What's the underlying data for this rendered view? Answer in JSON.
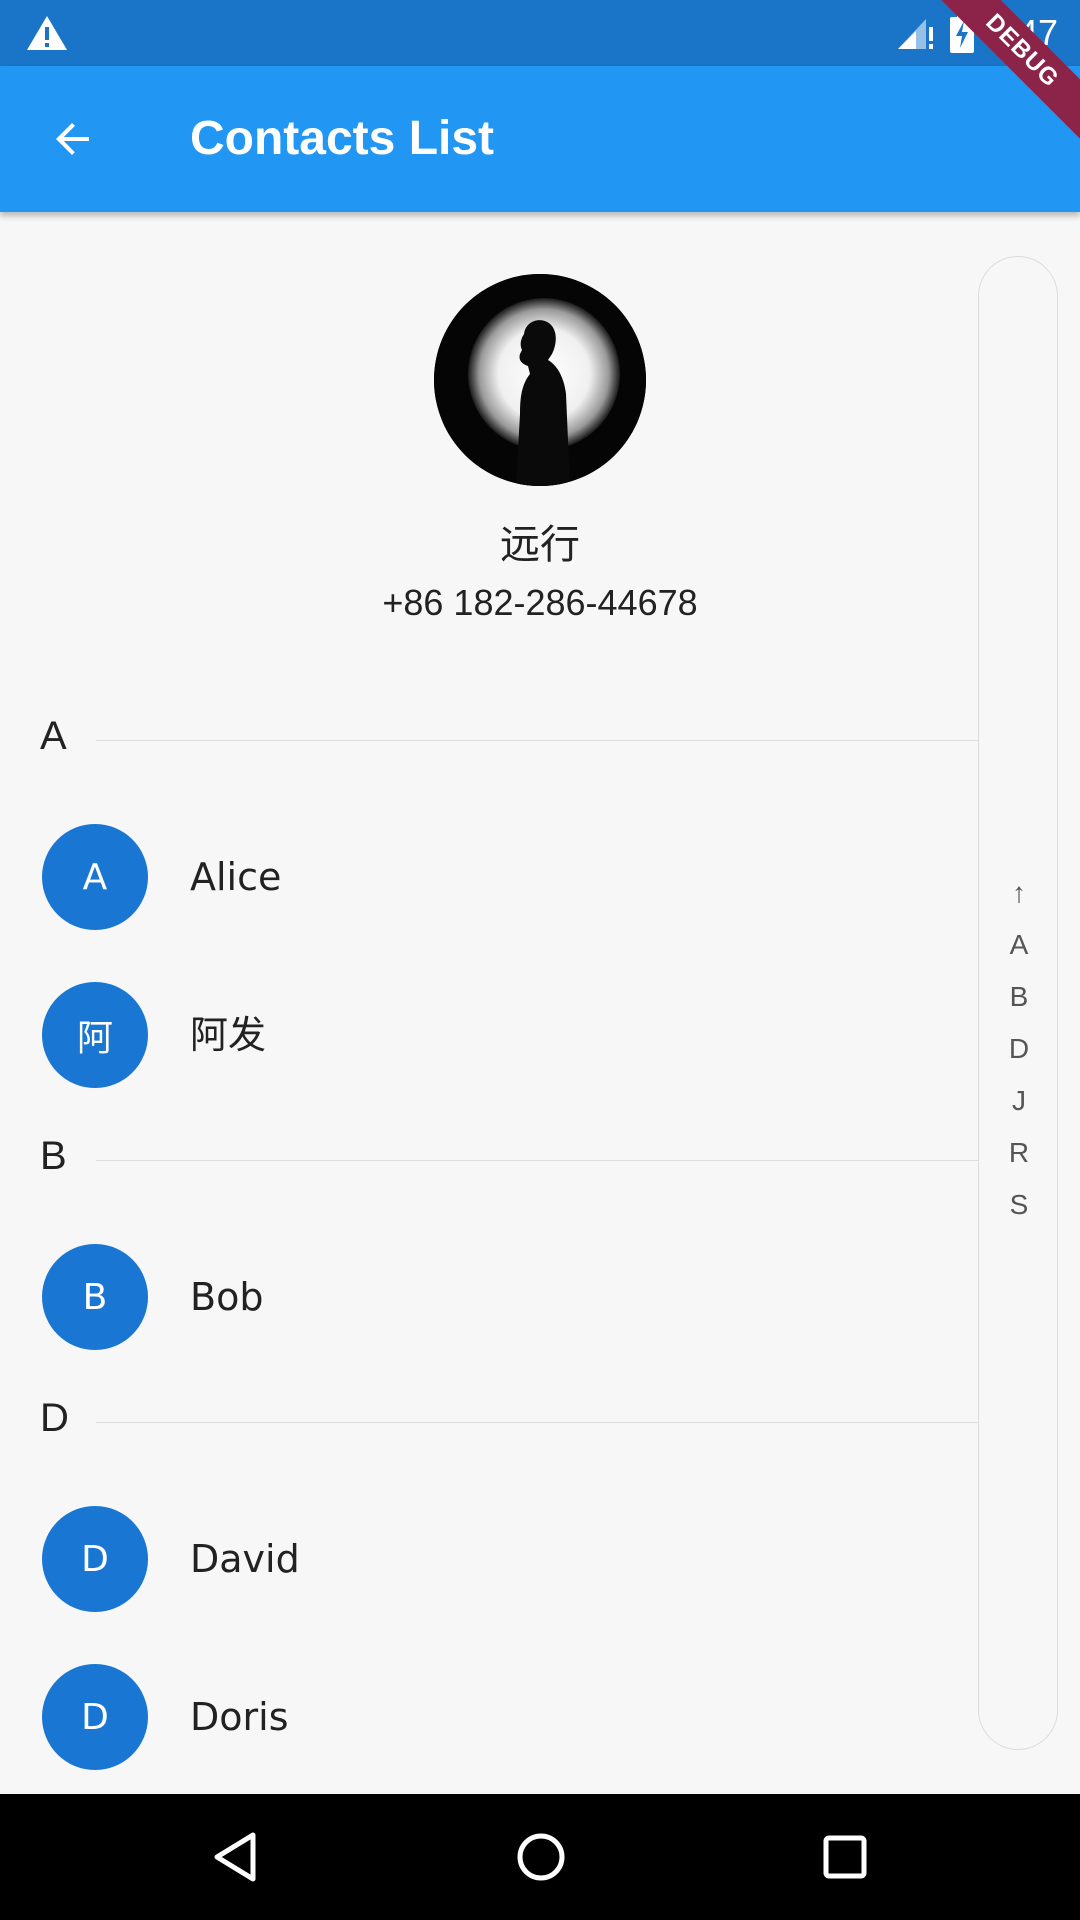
{
  "status_bar": {
    "time": "8:47",
    "debug_label": "DEBUG"
  },
  "app_bar": {
    "title": "Contacts List"
  },
  "profile": {
    "name": "远行",
    "phone": "+86 182-286-44678"
  },
  "sections": [
    {
      "letter": "A",
      "contacts": [
        {
          "initial": "A",
          "name": "Alice"
        },
        {
          "initial": "阿",
          "name": "阿发"
        }
      ]
    },
    {
      "letter": "B",
      "contacts": [
        {
          "initial": "B",
          "name": "Bob"
        }
      ]
    },
    {
      "letter": "D",
      "contacts": [
        {
          "initial": "D",
          "name": "David"
        },
        {
          "initial": "D",
          "name": "Doris"
        }
      ]
    }
  ],
  "index_bar": [
    "↑",
    "A",
    "B",
    "D",
    "J",
    "R",
    "S"
  ],
  "colors": {
    "app_bar": "#2196f3",
    "status_bar": "#1a74c8",
    "avatar": "#1976d2",
    "debug_banner": "#8c2449"
  }
}
